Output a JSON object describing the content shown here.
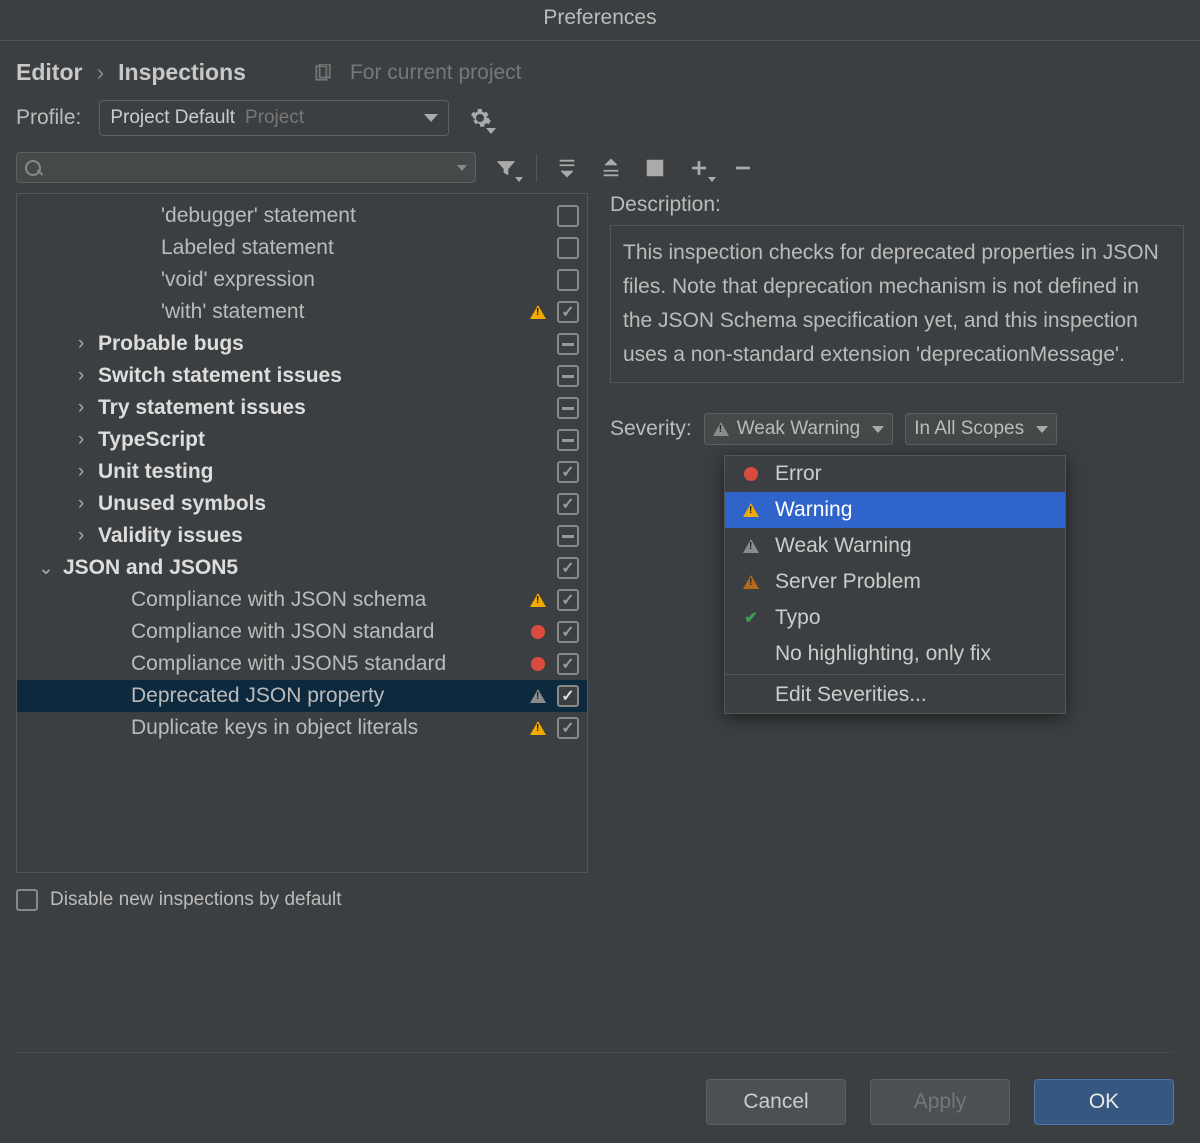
{
  "title": "Preferences",
  "breadcrumb": {
    "root": "Editor",
    "current": "Inspections"
  },
  "scope": "For current project",
  "profile": {
    "label": "Profile:",
    "value": "Project Default",
    "hint": "Project"
  },
  "search": {
    "placeholder": ""
  },
  "tree": [
    {
      "id": "debugger",
      "label": "'debugger' statement",
      "indent": "2n",
      "expander": "",
      "bold": false,
      "badge": "",
      "cb": "empty",
      "selected": false
    },
    {
      "id": "labeled",
      "label": "Labeled statement",
      "indent": "2n",
      "expander": "",
      "bold": false,
      "badge": "",
      "cb": "empty",
      "selected": false
    },
    {
      "id": "void",
      "label": "'void' expression",
      "indent": "2n",
      "expander": "",
      "bold": false,
      "badge": "",
      "cb": "empty",
      "selected": false
    },
    {
      "id": "with",
      "label": "'with' statement",
      "indent": "2n",
      "expander": "",
      "bold": false,
      "badge": "warn",
      "cb": "checked",
      "selected": false
    },
    {
      "id": "probbugs",
      "label": "Probable bugs",
      "indent": "1",
      "expander": ">",
      "bold": true,
      "badge": "",
      "cb": "mixed",
      "selected": false
    },
    {
      "id": "switch",
      "label": "Switch statement issues",
      "indent": "1",
      "expander": ">",
      "bold": true,
      "badge": "",
      "cb": "mixed",
      "selected": false
    },
    {
      "id": "try",
      "label": "Try statement issues",
      "indent": "1",
      "expander": ">",
      "bold": true,
      "badge": "",
      "cb": "mixed",
      "selected": false
    },
    {
      "id": "ts",
      "label": "TypeScript",
      "indent": "1",
      "expander": ">",
      "bold": true,
      "badge": "",
      "cb": "mixed",
      "selected": false
    },
    {
      "id": "unit",
      "label": "Unit testing",
      "indent": "1",
      "expander": ">",
      "bold": true,
      "badge": "",
      "cb": "checked",
      "selected": false
    },
    {
      "id": "unused",
      "label": "Unused symbols",
      "indent": "1",
      "expander": ">",
      "bold": true,
      "badge": "",
      "cb": "checked",
      "selected": false
    },
    {
      "id": "validity",
      "label": "Validity issues",
      "indent": "1",
      "expander": ">",
      "bold": true,
      "badge": "",
      "cb": "mixed",
      "selected": false
    },
    {
      "id": "json",
      "label": "JSON and JSON5",
      "indent": "0",
      "expander": "v",
      "bold": true,
      "badge": "",
      "cb": "checked",
      "selected": false
    },
    {
      "id": "jschema",
      "label": "Compliance with JSON schema",
      "indent": "2",
      "expander": "",
      "bold": false,
      "badge": "warn",
      "cb": "checked",
      "selected": false
    },
    {
      "id": "jstd",
      "label": "Compliance with JSON standard",
      "indent": "2",
      "expander": "",
      "bold": false,
      "badge": "error",
      "cb": "checked",
      "selected": false
    },
    {
      "id": "j5std",
      "label": "Compliance with JSON5 standard",
      "indent": "2",
      "expander": "",
      "bold": false,
      "badge": "error",
      "cb": "checked",
      "selected": false
    },
    {
      "id": "deprec",
      "label": "Deprecated JSON property",
      "indent": "2",
      "expander": "",
      "bold": false,
      "badge": "greywarn",
      "cb": "checked",
      "selected": true
    },
    {
      "id": "dupkeys",
      "label": "Duplicate keys in object literals",
      "indent": "2",
      "expander": "",
      "bold": false,
      "badge": "warn",
      "cb": "checked",
      "selected": false
    }
  ],
  "description": {
    "label": "Description:",
    "text": "This inspection checks for deprecated properties in JSON files. Note that deprecation mechanism is not defined in the JSON Schema specification yet, and this inspection uses a non-standard extension 'deprecationMessage'."
  },
  "severity": {
    "label": "Severity:",
    "selected": "Weak Warning",
    "scope": "In All Scopes",
    "options": [
      {
        "label": "Error",
        "icon": "error",
        "highlight": false
      },
      {
        "label": "Warning",
        "icon": "warn",
        "highlight": true
      },
      {
        "label": "Weak Warning",
        "icon": "greywarn",
        "highlight": false
      },
      {
        "label": "Server Problem",
        "icon": "darkwarn",
        "highlight": false
      },
      {
        "label": "Typo",
        "icon": "typo",
        "highlight": false
      },
      {
        "label": "No highlighting, only fix",
        "icon": "",
        "highlight": false
      }
    ],
    "edit": "Edit Severities..."
  },
  "disable_new": "Disable new inspections by default",
  "buttons": {
    "cancel": "Cancel",
    "apply": "Apply",
    "ok": "OK"
  }
}
